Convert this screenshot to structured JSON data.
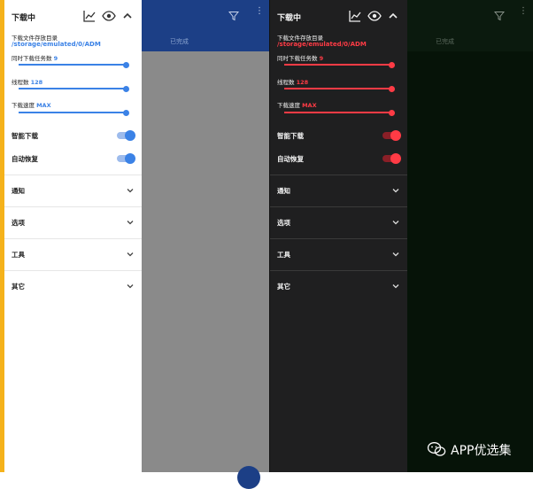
{
  "colors": {
    "light_accent": "#3b82e6",
    "dark_accent": "#ff3b45",
    "edge_accent": "#f5b21b",
    "light_appbar": "#1c3f86"
  },
  "drawer": {
    "title": "下载中",
    "icons": [
      "chart-icon",
      "eye-icon",
      "chevron-up-icon"
    ],
    "storage_label": "下载文件存放目录",
    "storage_path": "/storage/emulated/0/ADM",
    "concurrent_label": "同时下载任务数",
    "concurrent_value": "9",
    "concurrent_fraction": 1.0,
    "threads_label": "线程数",
    "threads_value": "128",
    "threads_fraction": 1.0,
    "speed_label": "下载速度",
    "speed_value": "MAX",
    "speed_fraction": 1.0,
    "smart_download_label": "智能下载",
    "smart_download_on": true,
    "auto_resume_label": "自动恢复",
    "auto_resume_on": true,
    "sections": [
      {
        "label": "通知"
      },
      {
        "label": "选项"
      },
      {
        "label": "工具"
      },
      {
        "label": "其它"
      }
    ]
  },
  "background": {
    "tab_completed": "已完成",
    "more_glyph": "⋮"
  },
  "watermark": {
    "text": "APP优选集"
  }
}
